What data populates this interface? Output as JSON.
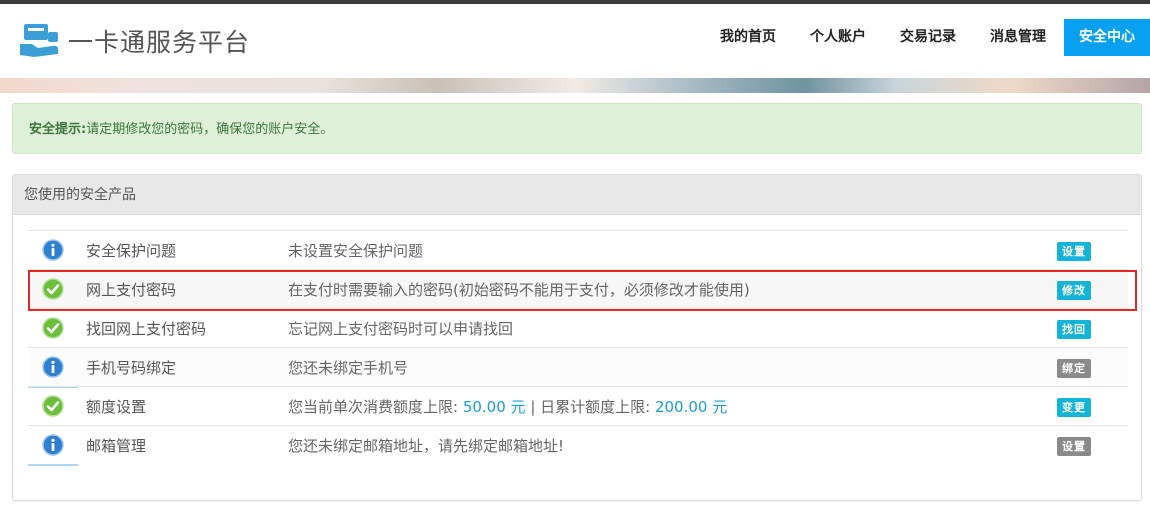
{
  "header": {
    "logo_text": "一卡通服务平台",
    "nav": [
      {
        "label": "我的首页"
      },
      {
        "label": "个人账户"
      },
      {
        "label": "交易记录"
      },
      {
        "label": "消息管理"
      },
      {
        "label": "安全中心",
        "active": true
      }
    ]
  },
  "alert": {
    "prefix": "安全提示:",
    "text": "请定期修改您的密码，确保您的账户安全。"
  },
  "panel": {
    "title": "您使用的安全产品",
    "rows": [
      {
        "icon": "info-icon",
        "name": "安全保护问题",
        "desc": "未设置安全保护问题",
        "button": "设置",
        "button_style": "blue"
      },
      {
        "icon": "check-icon",
        "name": "网上支付密码",
        "desc": "在支付时需要输入的密码(初始密码不能用于支付，必须修改才能使用)",
        "button": "修改",
        "button_style": "blue"
      },
      {
        "icon": "check-icon",
        "name": "找回网上支付密码",
        "desc": "忘记网上支付密码时可以申请找回",
        "button": "找回",
        "button_style": "blue"
      },
      {
        "icon": "info-icon",
        "name": "手机号码绑定",
        "desc": "您还未绑定手机号",
        "button": "绑定",
        "button_style": "gray"
      },
      {
        "icon": "check-icon",
        "name": "额度设置",
        "desc_prefix": "您当前单次消费额度上限: ",
        "single_limit": "50.00 元",
        "separator": " | ",
        "desc_mid": "日累计额度上限: ",
        "daily_limit": "200.00 元",
        "button": "变更",
        "button_style": "blue"
      },
      {
        "icon": "info-icon",
        "name": "邮箱管理",
        "desc": "您还未绑定邮箱地址，请先绑定邮箱地址!",
        "button": "设置",
        "button_style": "gray"
      }
    ]
  },
  "colors": {
    "accent": "#0aa0f0",
    "button_blue": "#14b4d8",
    "button_gray": "#8a8a8a",
    "alert_bg": "#dff0d8",
    "highlight": "#e02a2a"
  }
}
